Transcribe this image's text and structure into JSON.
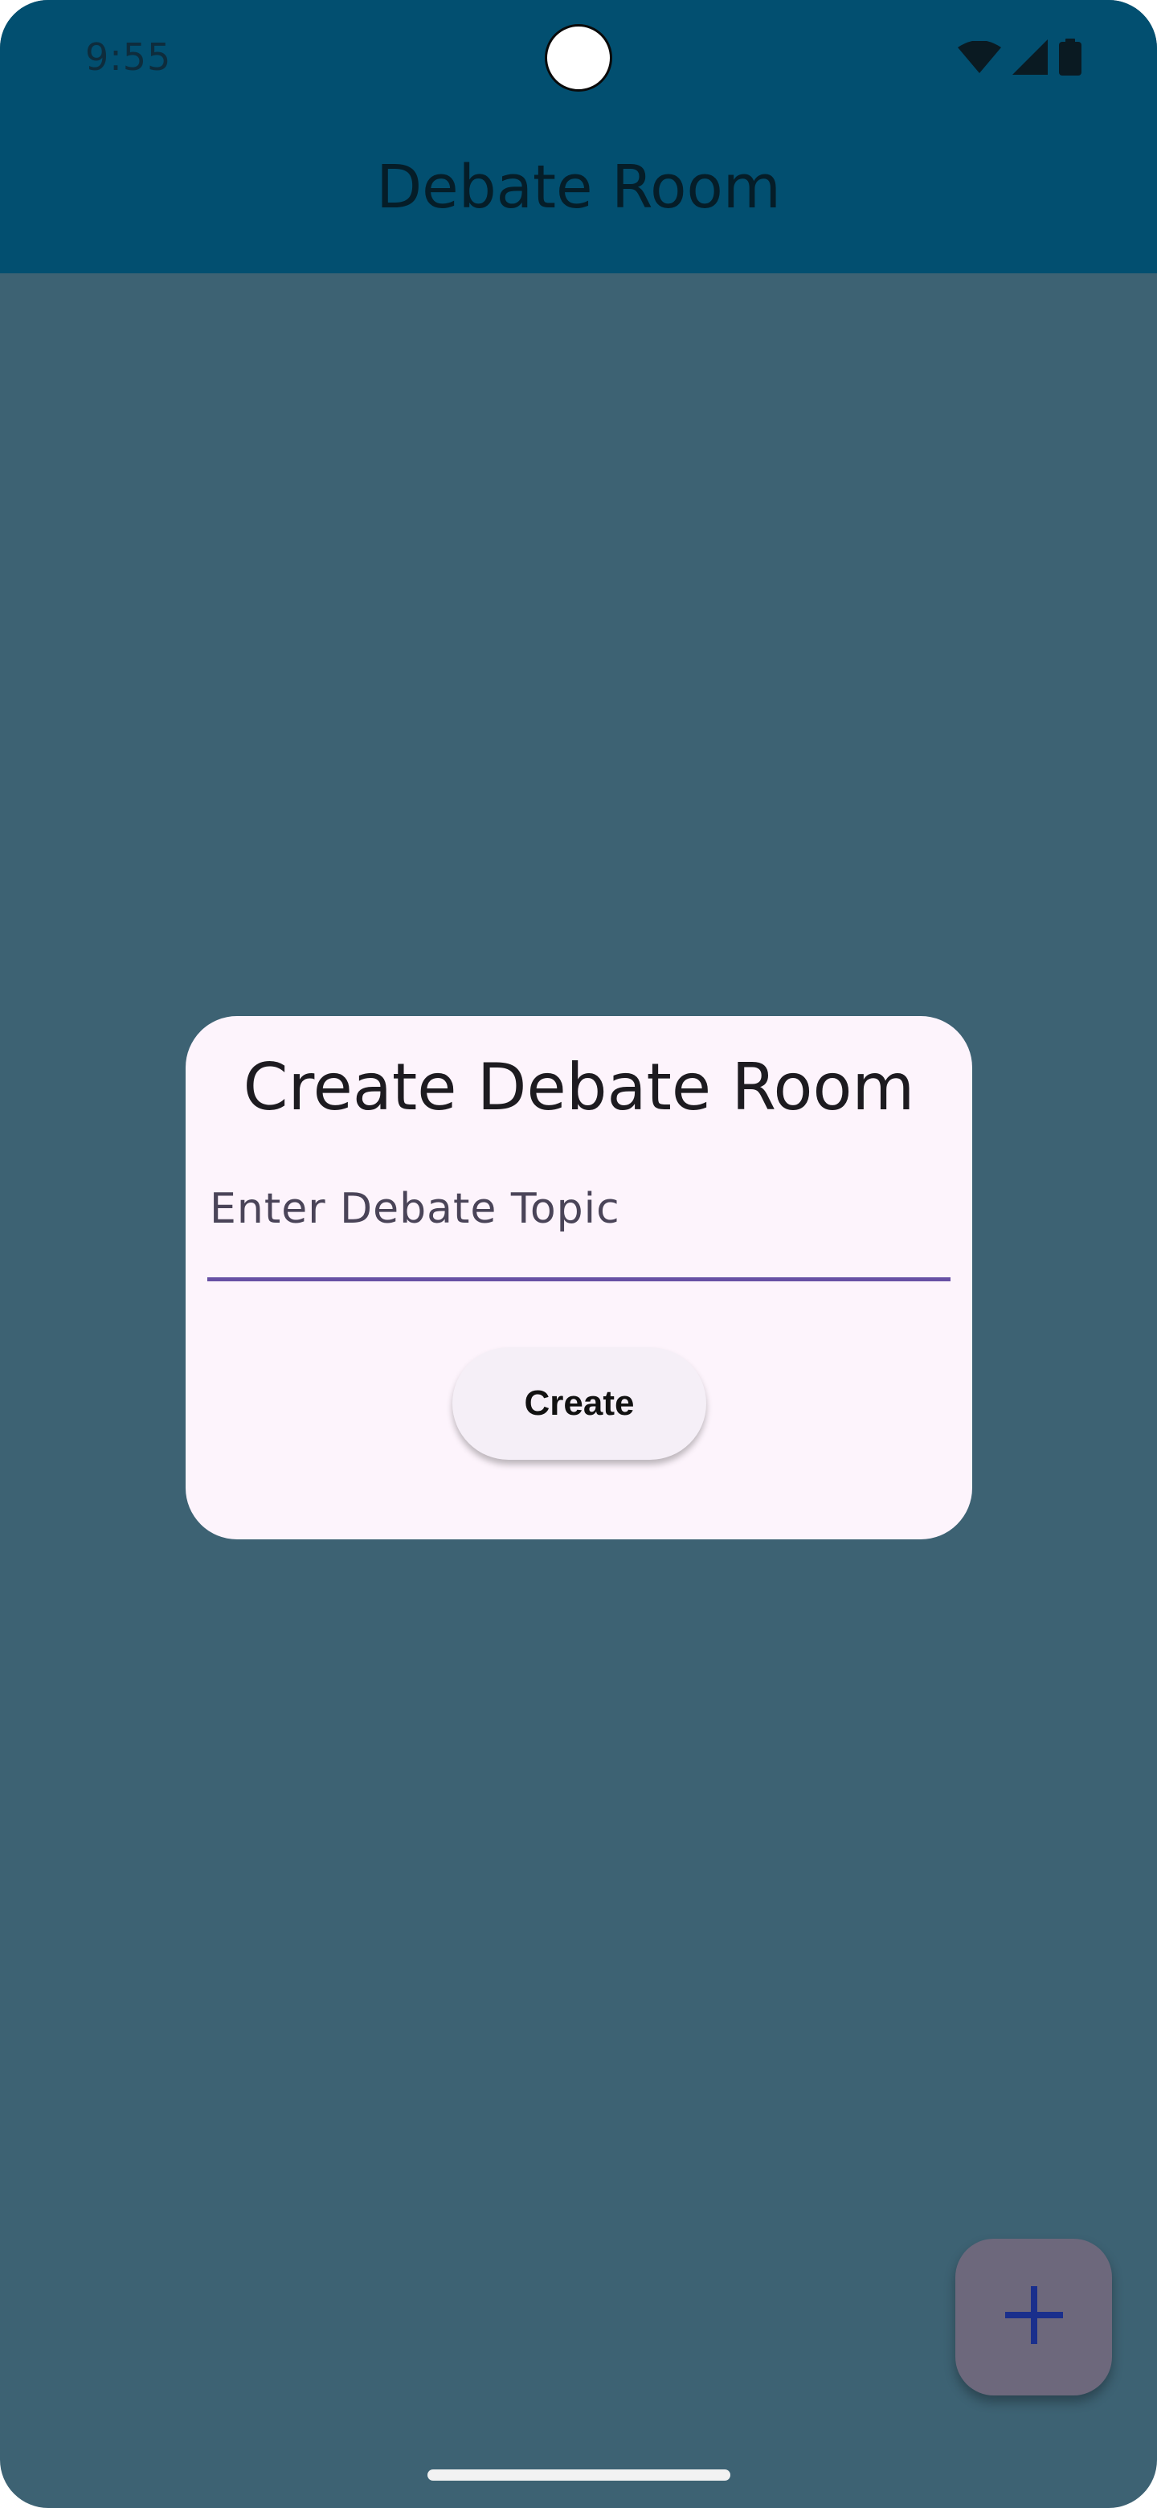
{
  "status_bar": {
    "time": "9:55",
    "icons": [
      "wifi-icon",
      "cellular-signal-icon",
      "battery-icon"
    ]
  },
  "app_bar": {
    "title": "Debate Room"
  },
  "dialog": {
    "title": "Create Debate Room",
    "topic_input": {
      "placeholder": "Enter Debate Topic",
      "value": ""
    },
    "create_label": "Create"
  },
  "fab": {
    "icon": "plus-icon"
  },
  "colors": {
    "app_bar": "#024f70",
    "scrim_background": "#3d6273",
    "dialog_surface": "#fdf4fc",
    "input_underline": "#6750a4",
    "fab": "#6d687c",
    "fab_icon": "#1a2f8c"
  }
}
